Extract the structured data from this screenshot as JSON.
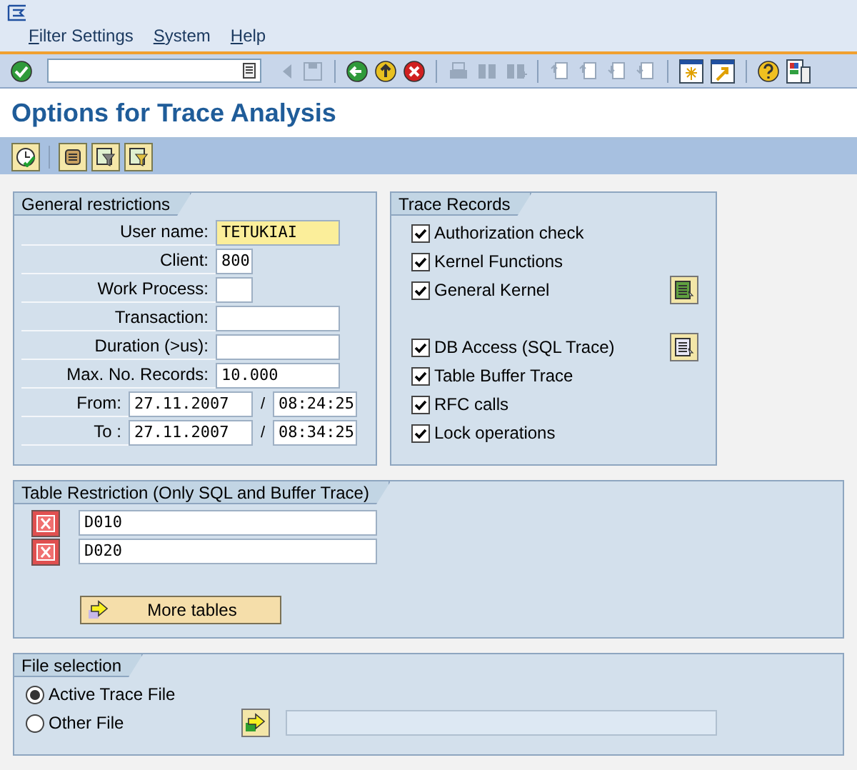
{
  "menu": [
    {
      "label": "Filter Settings"
    },
    {
      "label": "System"
    },
    {
      "label": "Help"
    }
  ],
  "toolbar": [
    {
      "kind": "enter",
      "disabled": false
    },
    {
      "kind": "command_field"
    },
    {
      "kind": "prev",
      "disabled": true
    },
    {
      "kind": "save",
      "disabled": true
    },
    {
      "kind": "sep"
    },
    {
      "kind": "back",
      "disabled": false
    },
    {
      "kind": "exit",
      "disabled": false
    },
    {
      "kind": "cancel",
      "disabled": false
    },
    {
      "kind": "sep"
    },
    {
      "kind": "print",
      "disabled": true
    },
    {
      "kind": "find",
      "disabled": true
    },
    {
      "kind": "find_next",
      "disabled": true
    },
    {
      "kind": "sep"
    },
    {
      "kind": "first_page",
      "disabled": true
    },
    {
      "kind": "prev_page",
      "disabled": true
    },
    {
      "kind": "next_page",
      "disabled": true
    },
    {
      "kind": "last_page",
      "disabled": true
    },
    {
      "kind": "sep"
    },
    {
      "kind": "new_session",
      "disabled": false
    },
    {
      "kind": "shortcut",
      "disabled": false
    },
    {
      "kind": "sep"
    },
    {
      "kind": "help",
      "disabled": false
    },
    {
      "kind": "layout",
      "disabled": false
    }
  ],
  "title": "Options for Trace Analysis",
  "app_toolbar": [
    {
      "kind": "execute"
    },
    {
      "kind": "sep"
    },
    {
      "kind": "scroll"
    },
    {
      "kind": "filter_save"
    },
    {
      "kind": "filter_load"
    }
  ],
  "general_restrictions": {
    "title": "General restrictions",
    "fields": [
      {
        "kind": "long_field",
        "label": "User name:",
        "value": "TETUKIAI",
        "focused": true
      },
      {
        "kind": "short_field",
        "label": "Client:",
        "value": "800",
        "focused": false
      },
      {
        "kind": "short_field",
        "label": "Work Process:",
        "focused": false
      },
      {
        "kind": "long_field",
        "label": "Transaction:",
        "focused": false
      },
      {
        "kind": "long_field",
        "label": "Duration (>us):",
        "focused": false
      },
      {
        "kind": "long_field",
        "label": "Max. No. Records:",
        "value": "10.000",
        "focused": false
      },
      {
        "kind": "date_time",
        "label": "From:",
        "date": "27.11.2007",
        "separator": "/",
        "time": "08:24:25"
      },
      {
        "kind": "date_time",
        "label": "To :",
        "date": "27.11.2007",
        "separator": "/",
        "time": "08:34:25"
      }
    ]
  },
  "trace_records": {
    "title": "Trace Records",
    "groups": [
      [
        {
          "label": "Authorization check",
          "checked": true,
          "details_button": false
        },
        {
          "label": "Kernel Functions",
          "checked": true,
          "details_button": false
        },
        {
          "label": "General Kernel",
          "checked": true,
          "details_button": true
        }
      ],
      [
        {
          "label": "DB Access (SQL Trace)",
          "checked": true,
          "details_button": true
        },
        {
          "label": "Table Buffer Trace",
          "checked": true,
          "details_button": false
        },
        {
          "label": "RFC calls",
          "checked": true,
          "details_button": false
        },
        {
          "label": "Lock operations",
          "checked": true,
          "details_button": false
        }
      ]
    ]
  },
  "table_restriction": {
    "title": "Table Restriction (Only SQL and Buffer Trace)",
    "tables": [
      "D010",
      "D020"
    ],
    "button": "More tables"
  },
  "file_selection": {
    "title": "File selection",
    "options": [
      {
        "label": "Active Trace File",
        "selected": true
      },
      {
        "label": "Other File",
        "selected": false
      }
    ]
  }
}
